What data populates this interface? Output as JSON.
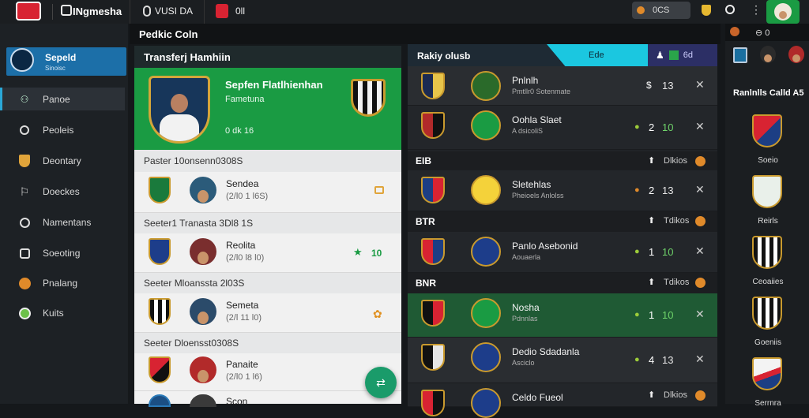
{
  "colors": {
    "accent_green": "#1a9b43",
    "accent_cyan": "#1bc7e0",
    "brand_red": "#d82332",
    "orange": "#e08a2a"
  },
  "topbar": {
    "brand": "INgmesha",
    "tab1": "VUSI DA",
    "tab2": "0ll",
    "pill": "0CS"
  },
  "sidebar": {
    "profile": {
      "name": "Sepeld",
      "sub": "Sinoisc"
    },
    "items": [
      {
        "label": "Panoe",
        "icon": "players-icon"
      },
      {
        "label": "Peoleis",
        "icon": "pin-icon"
      },
      {
        "label": "Deontary",
        "icon": "shield-icon"
      },
      {
        "label": "Doeckes",
        "icon": "whistle-icon"
      },
      {
        "label": "Namentans",
        "icon": "ball-icon"
      },
      {
        "label": "Soeoting",
        "icon": "target-icon"
      },
      {
        "label": "Pnalang",
        "icon": "orange-ball-icon"
      },
      {
        "label": "Kuits",
        "icon": "green-ball-icon"
      }
    ]
  },
  "header": {
    "title": "Pedkic Coln"
  },
  "transfer": {
    "title": "Transferj Hamhiin",
    "hero": {
      "name": "Sepfen Flatlhienhan",
      "line1": "Fametuna",
      "line2": "0 dk 16"
    },
    "groups": [
      {
        "title": "Paster 10onsenn0308S",
        "rows": [
          {
            "name": "Sendea",
            "detail": "(2/l0 1 l6S)"
          }
        ]
      },
      {
        "title": "Seeter1 Tranasta 3Dl8 1S",
        "rows": [
          {
            "name": "Reolita",
            "detail": "(2/l0 l8 l0)",
            "stat": "10"
          }
        ]
      },
      {
        "title": "Seeter Mloanssta 2l03S",
        "rows": [
          {
            "name": "Semeta",
            "detail": "(2/l 11 l0)"
          }
        ]
      },
      {
        "title": "Seeter Dloensst0308S",
        "rows": [
          {
            "name": "Panaite",
            "detail": "(2/l0 1 l6)"
          }
        ]
      }
    ],
    "last_row": {
      "name": "Scon"
    }
  },
  "rankings": {
    "title": "Rakiy olusb",
    "tab_cyan": "Ede",
    "tab_icons": "6d",
    "rows": [
      {
        "kind": "row",
        "name": "Pnlnlh",
        "sub": "Pmtllr0 Sotenmate",
        "a": "13"
      },
      {
        "kind": "row",
        "name": "Oohla Slaet",
        "sub": "A dsicoliS",
        "b": "2",
        "a": "10"
      },
      {
        "kind": "sep",
        "label": "EIB",
        "meta": "Dlkios"
      },
      {
        "kind": "row",
        "name": "Sletehlas",
        "sub": "Pheioels Anlolss",
        "b": "2",
        "a": "13"
      },
      {
        "kind": "sep",
        "label": "BTR",
        "meta": "Tdikos"
      },
      {
        "kind": "row",
        "name": "Panlo Asebonid",
        "sub": "Aouaerla",
        "b": "1",
        "a": "10"
      },
      {
        "kind": "sep",
        "label": "BNR",
        "meta": "Tdikos"
      },
      {
        "kind": "row",
        "name": "Nosha",
        "sub": "Pdnnlas",
        "b": "1",
        "a": "10"
      },
      {
        "kind": "row",
        "name": "Dedio Sdadanla",
        "sub": "Asciclo",
        "b": "4",
        "a": "13"
      },
      {
        "kind": "row",
        "name": "Celdo Fueol",
        "meta": "Dlkios"
      }
    ]
  },
  "right": {
    "title": "Ranlnlls Calld A5",
    "clubs": [
      "Soeio",
      "Reirls",
      "Ceoaiies",
      "Goeniis",
      "Serrnra"
    ]
  }
}
